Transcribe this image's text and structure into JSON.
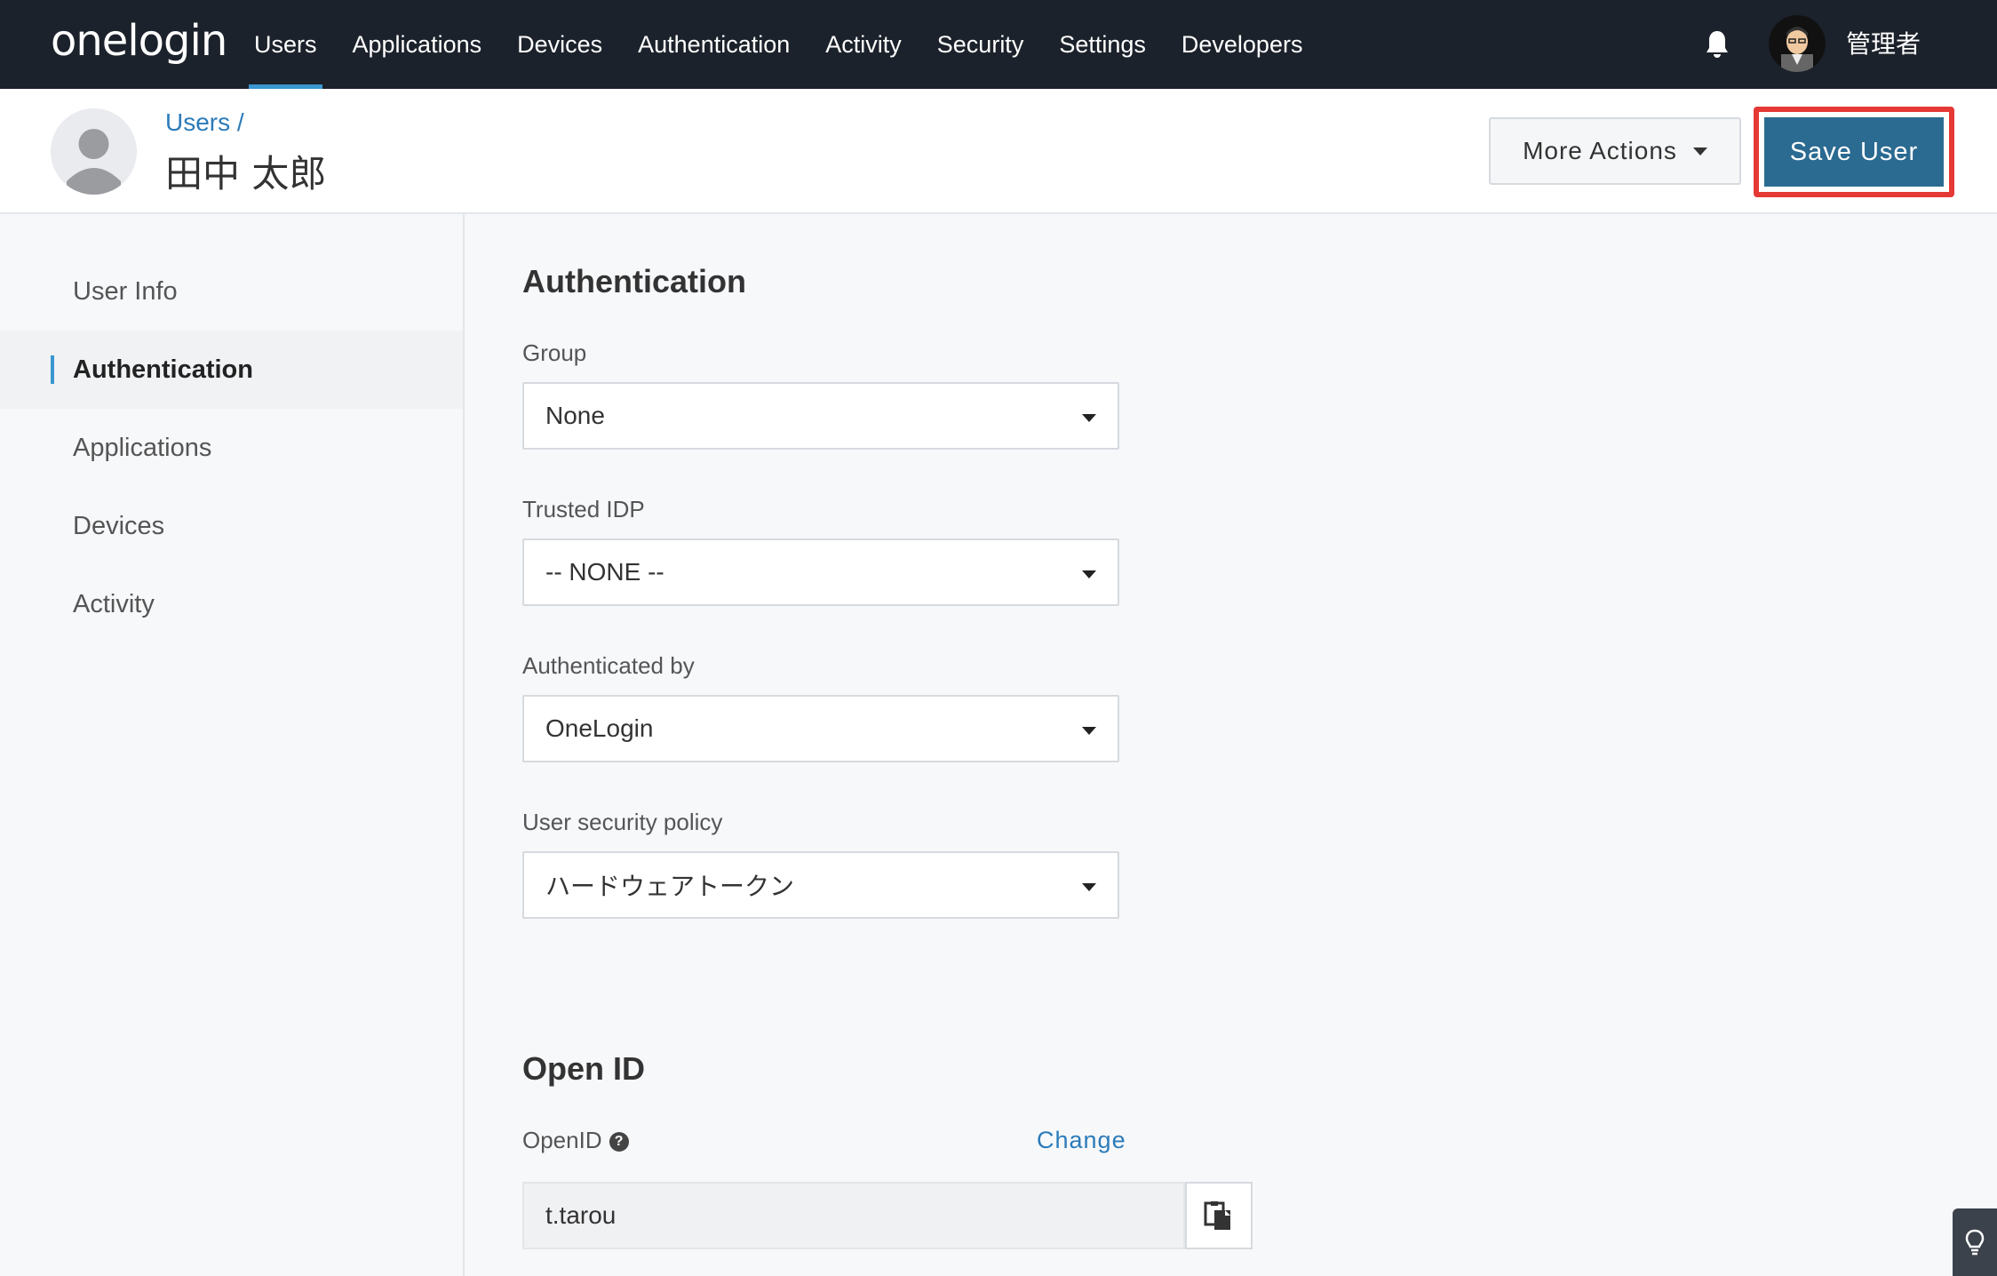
{
  "app": {
    "logo_text": "onelogin"
  },
  "nav": {
    "items": [
      {
        "label": "Users",
        "active": true
      },
      {
        "label": "Applications"
      },
      {
        "label": "Devices"
      },
      {
        "label": "Authentication"
      },
      {
        "label": "Activity"
      },
      {
        "label": "Security"
      },
      {
        "label": "Settings"
      },
      {
        "label": "Developers"
      }
    ],
    "user_name": "管理者"
  },
  "header": {
    "breadcrumb": "Users /",
    "title": "田中 太郎",
    "more_actions_label": "More Actions",
    "save_label": "Save User"
  },
  "sidebar": {
    "items": [
      {
        "label": "User Info"
      },
      {
        "label": "Authentication",
        "active": true
      },
      {
        "label": "Applications"
      },
      {
        "label": "Devices"
      },
      {
        "label": "Activity"
      }
    ]
  },
  "authentication": {
    "title": "Authentication",
    "group": {
      "label": "Group",
      "value": "None"
    },
    "trusted_idp": {
      "label": "Trusted IDP",
      "value": "-- NONE --"
    },
    "authenticated_by": {
      "label": "Authenticated by",
      "value": "OneLogin"
    },
    "security_policy": {
      "label": "User security policy",
      "value": "ハードウェアトークン"
    }
  },
  "openid": {
    "title": "Open ID",
    "label": "OpenID",
    "change_label": "Change",
    "value": "t.tarou"
  },
  "colors": {
    "nav_bg": "#1c222b",
    "accent": "#3a96d1",
    "save_button": "#2b6a91",
    "highlight": "#e53935",
    "link": "#2b7bb9"
  }
}
